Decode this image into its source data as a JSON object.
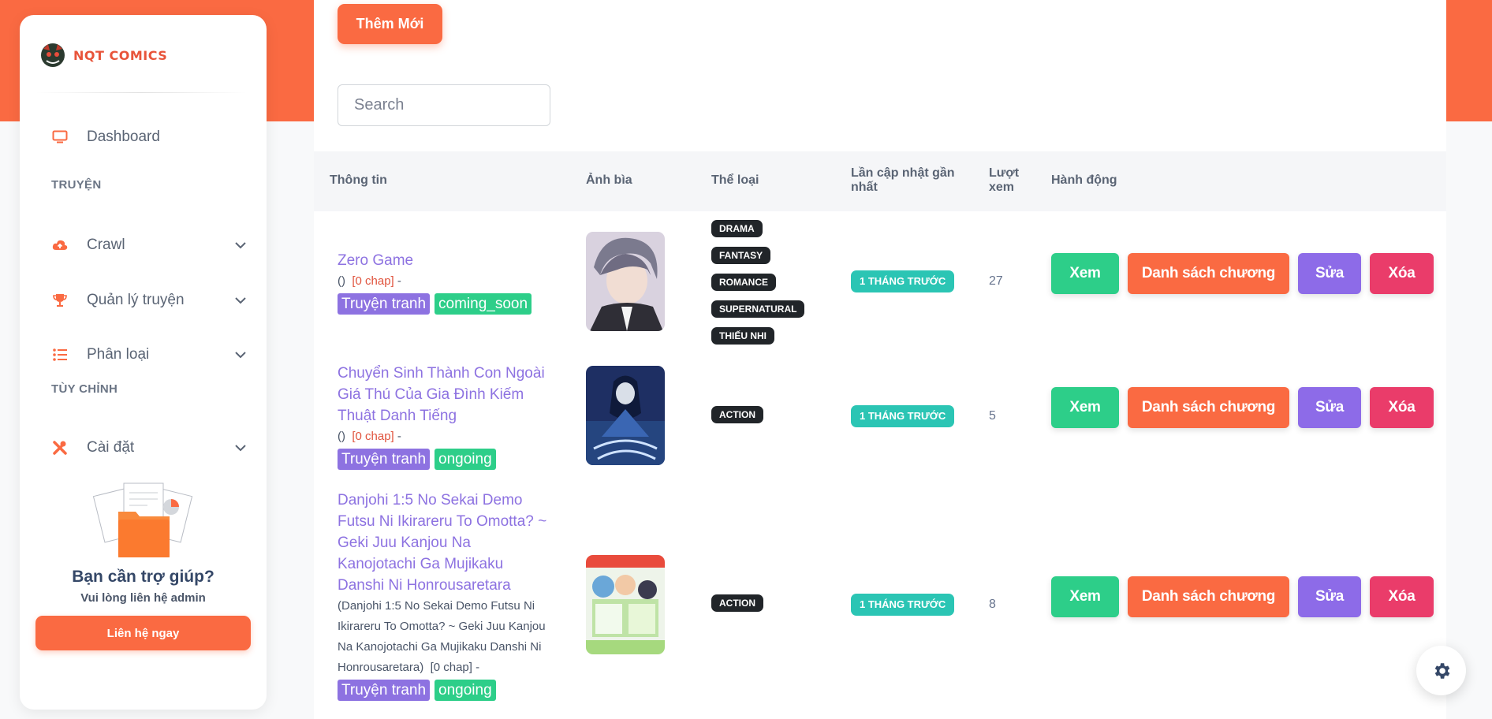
{
  "brand": {
    "name": "NQT COMICS"
  },
  "sidebar": {
    "items": [
      {
        "label": "Dashboard"
      },
      {
        "label": "Crawl"
      },
      {
        "label": "Quản lý truyện"
      },
      {
        "label": "Phân loại"
      },
      {
        "label": "Cài đặt"
      }
    ],
    "sections": [
      "TRUYỆN",
      "TÙY CHỈNH"
    ]
  },
  "help": {
    "title": "Bạn cần trợ giúp?",
    "subtitle": "Vui lòng liên hệ admin",
    "button": "Liên hệ ngay"
  },
  "toolbar": {
    "add_label": "Thêm Mới",
    "search_placeholder": "Search"
  },
  "table": {
    "headers": {
      "info": "Thông tin",
      "cover": "Ảnh bìa",
      "genre": "Thể loại",
      "updated": "Lần cập nhật gần nhất",
      "views": "Lượt xem",
      "actions": "Hành động"
    },
    "rows": [
      {
        "title": "Zero Game",
        "alt": "()",
        "chap": "[0 chap]",
        "dash": "-",
        "type": "Truyện tranh",
        "status": "coming_soon",
        "genres": [
          "DRAMA",
          "FANTASY",
          "ROMANCE",
          "SUPERNATURAL",
          "THIẾU NHI"
        ],
        "updated": "1 THÁNG TRƯỚC",
        "views": "27"
      },
      {
        "title": "Chuyển Sinh Thành Con Ngoài Giá Thú Của Gia Đình Kiếm Thuật Danh Tiếng",
        "alt": "()",
        "chap": "[0 chap]",
        "dash": "-",
        "type": "Truyện tranh",
        "status": "ongoing",
        "genres": [
          "ACTION"
        ],
        "updated": "1 THÁNG TRƯỚC",
        "views": "5"
      },
      {
        "title": "Danjohi 1:5 No Sekai Demo Futsu Ni Ikirareru To Omotta? ~ Geki Juu Kanjou Na Kanojotachi Ga Mujikaku Danshi Ni Honrousaretara",
        "alt": "(Danjohi 1:5 No Sekai Demo Futsu Ni Ikirareru To Omotta? ~ Geki Juu Kanjou Na Kanojotachi Ga Mujikaku Danshi Ni Honrousaretara)",
        "chap": "[0 chap]",
        "dash": "-",
        "type": "Truyện tranh",
        "status": "ongoing",
        "genres": [
          "ACTION"
        ],
        "updated": "1 THÁNG TRƯỚC",
        "views": "8"
      }
    ],
    "actions": {
      "view": "Xem",
      "chapters": "Danh sách chương",
      "edit": "Sửa",
      "delete": "Xóa"
    }
  },
  "colors": {
    "accent": "#fa6a42",
    "purple": "#8d72e1",
    "green": "#2dce89",
    "teal": "#2bc5b4",
    "red": "#ea3c6a"
  },
  "icons": [
    "monitor-icon",
    "cloud-upload-icon",
    "trophy-icon",
    "list-icon",
    "tools-icon",
    "chevron-down-icon",
    "gear-icon"
  ]
}
